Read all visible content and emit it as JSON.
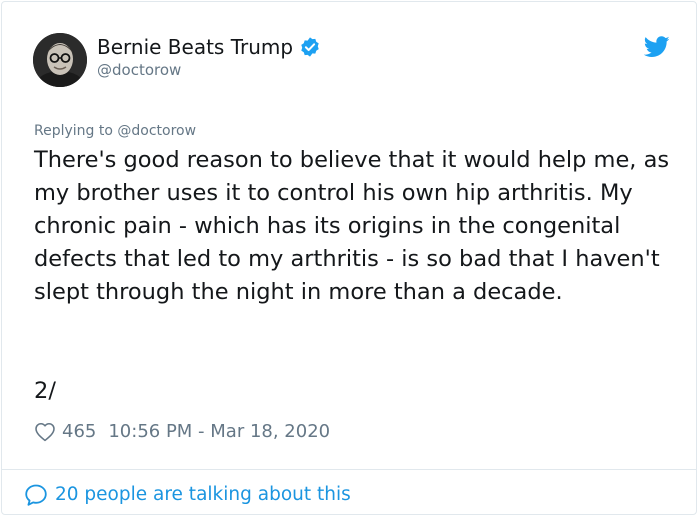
{
  "author": {
    "display_name": "Bernie Beats Trump",
    "handle": "@doctorow",
    "verified": true,
    "avatar_icon": "profile-photo"
  },
  "reply": {
    "prefix": "Replying to",
    "handle": "@doctorow"
  },
  "tweet": {
    "text": "There's good reason to believe that it would help me, as my brother uses it to control his own hip arthritis. My chronic pain - which has its origins in the congenital defects that led to my arthritis - is so bad that I haven't slept through the night in more than a decade.",
    "thread_number": "2/"
  },
  "stats": {
    "likes": "465",
    "timestamp": "10:56 PM - Mar 18, 2020"
  },
  "footer": {
    "talking": "20 people are talking about this"
  },
  "colors": {
    "accent": "#1b95e0",
    "twitter_blue": "#1da1f2",
    "secondary_text": "#657786",
    "primary_text": "#14171a",
    "border": "#e1e8ed"
  },
  "icons": {
    "verified": "verified-badge-icon",
    "brand": "twitter-bird-icon",
    "like": "heart-icon",
    "reply": "speech-bubble-icon"
  }
}
